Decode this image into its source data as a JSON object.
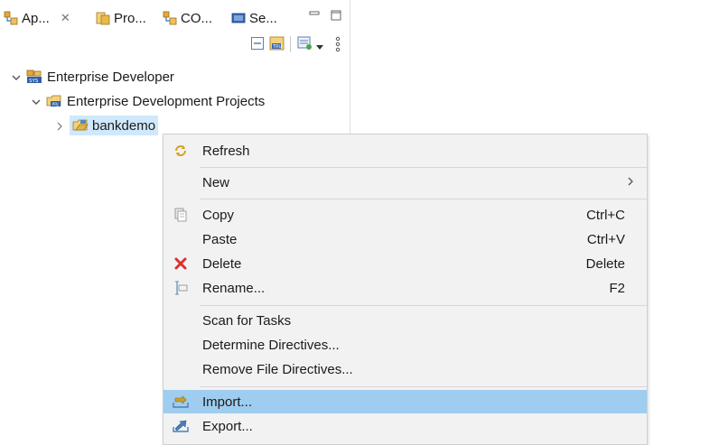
{
  "tabs": [
    {
      "label": "Ap...",
      "icon": "application-explorer-icon"
    },
    {
      "label": "Pro...",
      "icon": "project-explorer-icon"
    },
    {
      "label": "CO...",
      "icon": "cobol-explorer-icon"
    },
    {
      "label": "Se...",
      "icon": "server-explorer-icon"
    }
  ],
  "tab_close_glyph": "✕",
  "tree": {
    "root": {
      "label": "Enterprise Developer"
    },
    "group": {
      "label": "Enterprise Development Projects"
    },
    "project": {
      "label": "bankdemo"
    }
  },
  "menu": {
    "refresh": {
      "label": "Refresh"
    },
    "new": {
      "label": "New"
    },
    "copy": {
      "label": "Copy",
      "shortcut": "Ctrl+C"
    },
    "paste": {
      "label": "Paste",
      "shortcut": "Ctrl+V"
    },
    "delete": {
      "label": "Delete",
      "shortcut": "Delete"
    },
    "rename": {
      "label": "Rename...",
      "shortcut": "F2"
    },
    "scan_tasks": {
      "label": "Scan for Tasks"
    },
    "determine_directives": {
      "label": "Determine Directives..."
    },
    "remove_file_directives": {
      "label": "Remove File Directives..."
    },
    "import": {
      "label": "Import..."
    },
    "export": {
      "label": "Export..."
    }
  },
  "colors": {
    "highlight": "#9fcdf0",
    "selection": "#cfe8fb",
    "delete_icon": "#d93030"
  }
}
